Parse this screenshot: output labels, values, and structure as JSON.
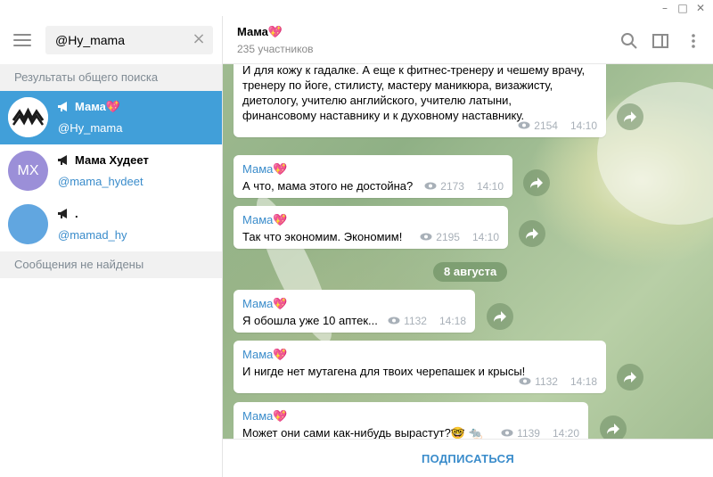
{
  "window": {
    "minimize": "–",
    "maximize": "□",
    "close": "✕"
  },
  "search": {
    "value": "@Hy_mama",
    "placeholder": ""
  },
  "sections": {
    "global_results": "Результаты общего поиска",
    "no_messages": "Сообщения не найдены"
  },
  "results": [
    {
      "name": "Мама",
      "name_emoji": "💖",
      "username": "@Hy_mama",
      "avatar_color": "#ffffff",
      "active": true
    },
    {
      "name": "Мама Худеет",
      "name_emoji": "",
      "username": "@mama_hydeet",
      "avatar_text": "МХ",
      "avatar_color": "#9b8fd8",
      "active": false
    },
    {
      "name": ".",
      "name_emoji": "",
      "username": "@mamad_hy",
      "avatar_color": "#61a6e0",
      "active": false
    }
  ],
  "chat": {
    "title": "Мама",
    "title_emoji": "💖",
    "subtitle": "235 участников",
    "header_icons": [
      "search-icon",
      "sidebar-toggle-icon",
      "more-vertical-icon"
    ]
  },
  "messages": [
    {
      "author": "",
      "lines": [
        "И для кожу к гадалке. А еще к фитнес-тренеру и чешему врачу,",
        "тренеру по йоге, стилисту, мастеру маникюра, визажисту,",
        "диетологу, учителю английского, учителю латыни,",
        "финансовому наставнику и к духовному наставнику."
      ],
      "views": "2154",
      "time": "14:10"
    },
    {
      "author": "Мама",
      "author_emoji": "💖",
      "lines": [
        "А что, мама этого не достойна?"
      ],
      "views": "2173",
      "time": "14:10"
    },
    {
      "author": "Мама",
      "author_emoji": "💖",
      "lines": [
        "Так что экономим. Экономим!"
      ],
      "views": "2195",
      "time": "14:10"
    },
    {
      "author": "Мама",
      "author_emoji": "💖",
      "lines": [
        "Я обошла уже 10 аптек..."
      ],
      "views": "1132",
      "time": "14:18"
    },
    {
      "author": "Мама",
      "author_emoji": "💖",
      "lines": [
        "И нигде нет мутагена для твоих черепашек и крысы!"
      ],
      "views": "1132",
      "time": "14:18"
    },
    {
      "author": "Мама",
      "author_emoji": "💖",
      "lines": [
        "Может они сами как-нибудь вырастут?🤓 🐀"
      ],
      "views": "1139",
      "time": "14:20"
    }
  ],
  "date_divider": "8 августа",
  "footer": {
    "subscribe": "ПОДПИСАТЬСЯ"
  },
  "colors": {
    "accent": "#419fd9",
    "link": "#3a8ccb",
    "heart": "#f0519d"
  }
}
